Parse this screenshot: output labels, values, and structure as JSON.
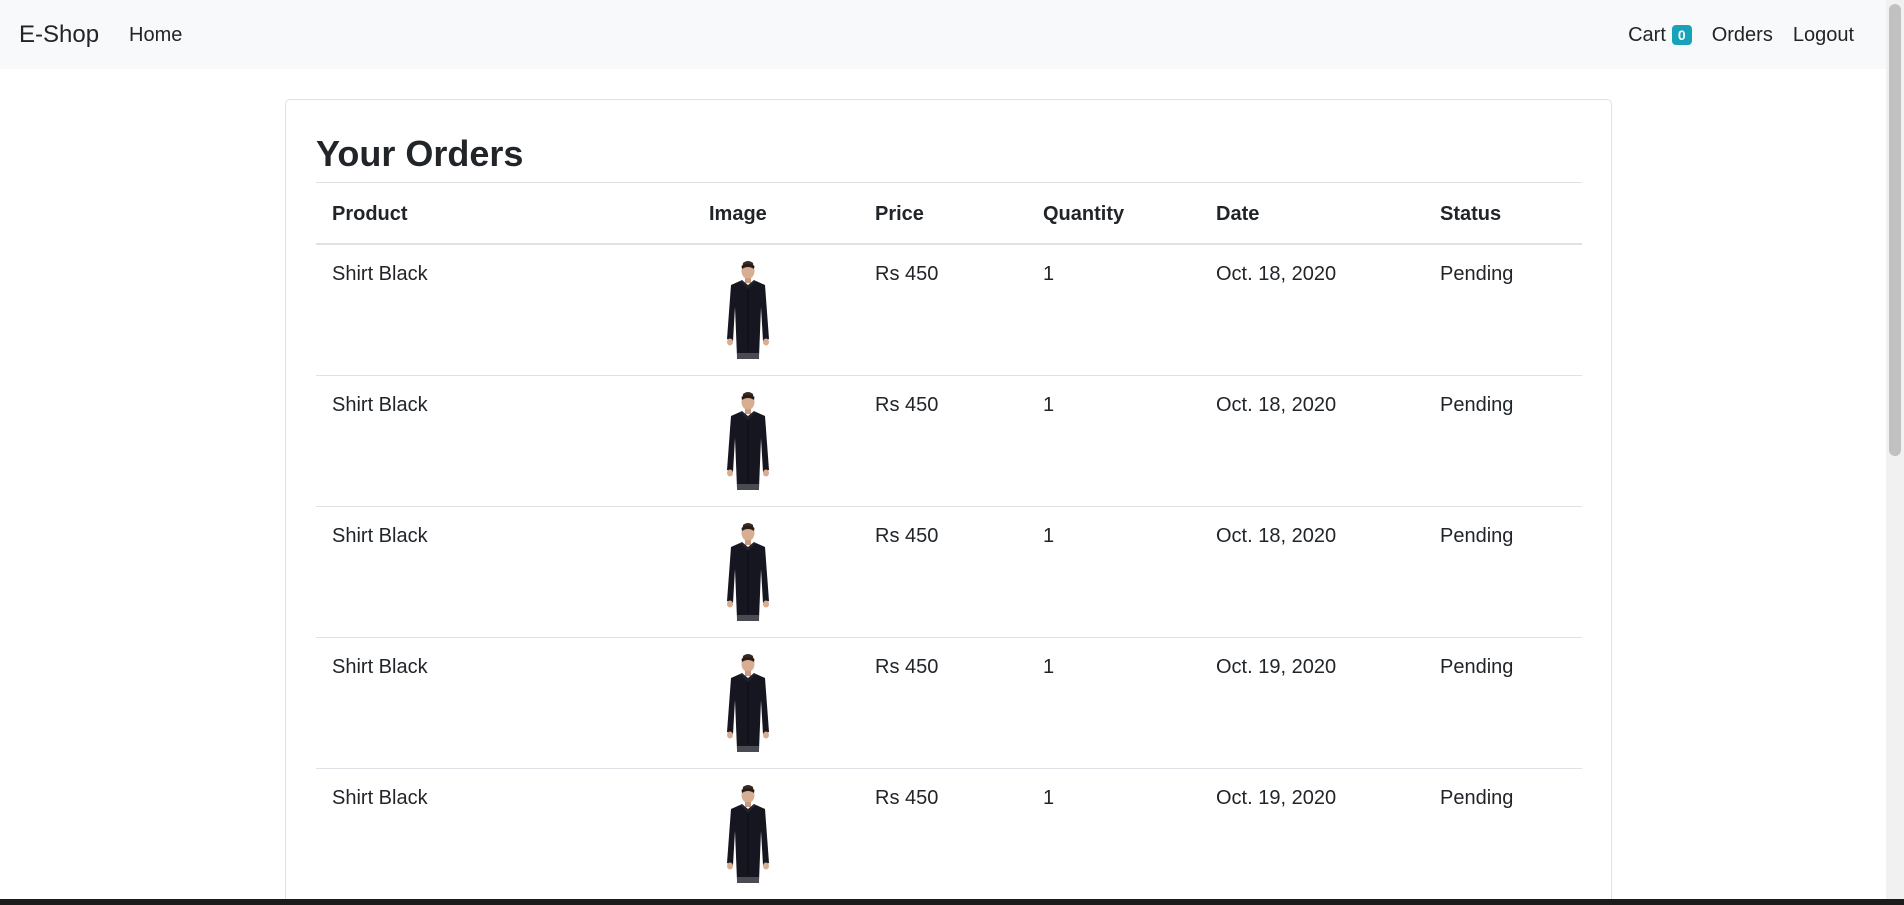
{
  "navbar": {
    "brand": "E-Shop",
    "home": "Home",
    "cart_label": "Cart",
    "cart_count": "0",
    "orders": "Orders",
    "logout": "Logout"
  },
  "page": {
    "title": "Your Orders"
  },
  "table": {
    "headers": [
      "Product",
      "Image",
      "Price",
      "Quantity",
      "Date",
      "Status"
    ],
    "rows": [
      {
        "product": "Shirt Black",
        "image": "shirt-black-icon",
        "price": "Rs 450",
        "quantity": "1",
        "date": "Oct. 18, 2020",
        "status": "Pending"
      },
      {
        "product": "Shirt Black",
        "image": "shirt-black-icon",
        "price": "Rs 450",
        "quantity": "1",
        "date": "Oct. 18, 2020",
        "status": "Pending"
      },
      {
        "product": "Shirt Black",
        "image": "shirt-black-icon",
        "price": "Rs 450",
        "quantity": "1",
        "date": "Oct. 18, 2020",
        "status": "Pending"
      },
      {
        "product": "Shirt Black",
        "image": "shirt-black-icon",
        "price": "Rs 450",
        "quantity": "1",
        "date": "Oct. 19, 2020",
        "status": "Pending"
      },
      {
        "product": "Shirt Black",
        "image": "shirt-black-icon",
        "price": "Rs 450",
        "quantity": "1",
        "date": "Oct. 19, 2020",
        "status": "Pending"
      }
    ]
  },
  "colors": {
    "navbar_bg": "#f8f9fa",
    "badge_bg": "#17a2b8",
    "text": "#212529",
    "border": "#dee2e6"
  }
}
